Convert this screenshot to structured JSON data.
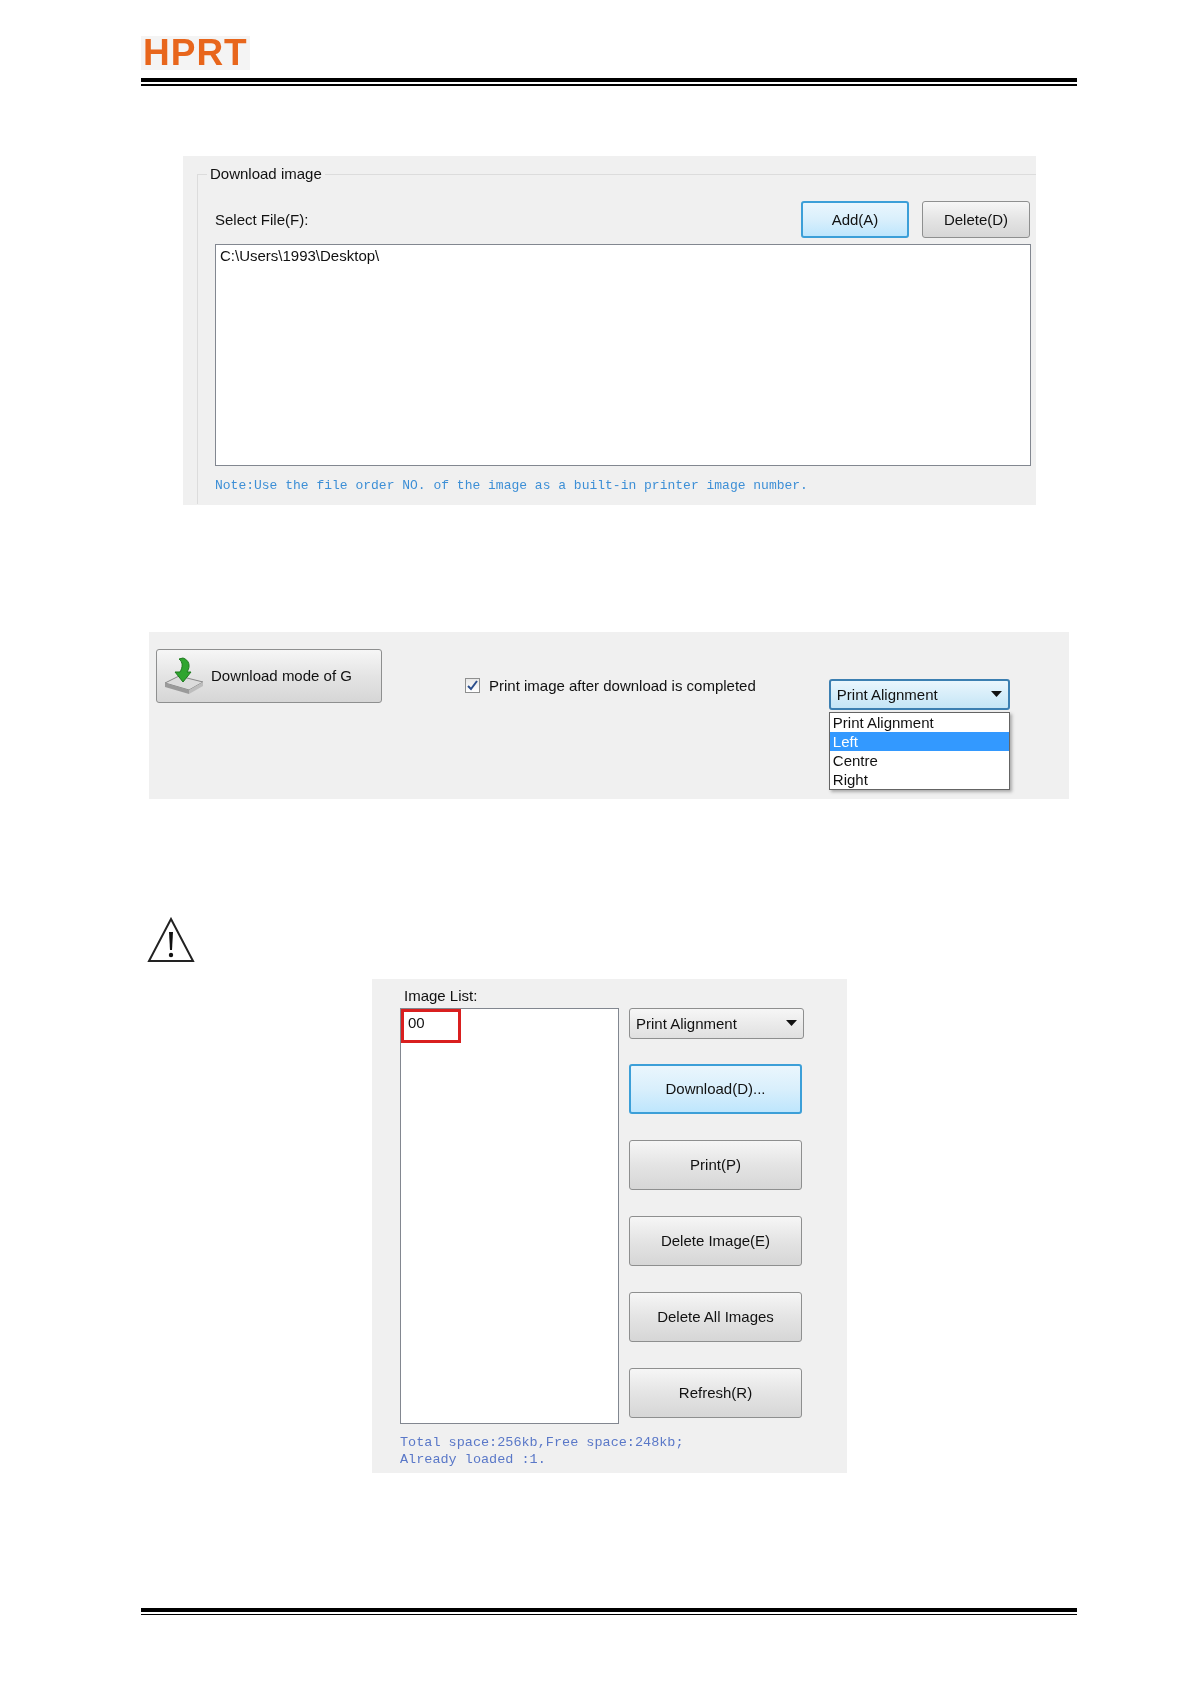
{
  "header": {
    "logo": "HPRT"
  },
  "download_image_panel": {
    "group_title": "Download image",
    "select_file_label": "Select File(F):",
    "buttons": [
      {
        "label": "Add(A)",
        "focused": true
      },
      {
        "label": "Delete(D)",
        "focused": false
      }
    ],
    "file_list": [
      "C:\\Users\\1993\\Desktop\\"
    ],
    "note": "Note:Use the file order NO. of the image as a built-in printer image number."
  },
  "download_mode_panel": {
    "mode_button": "Download mode of G",
    "print_after_checkbox": {
      "label": "Print image after download is completed",
      "checked": true
    },
    "alignment_dropdown": {
      "value": "Print Alignment",
      "expanded": true,
      "options": [
        {
          "label": "Print Alignment",
          "highlighted": false
        },
        {
          "label": "Left",
          "highlighted": true
        },
        {
          "label": "Centre",
          "highlighted": false
        },
        {
          "label": "Right",
          "highlighted": false
        }
      ]
    }
  },
  "image_list_panel": {
    "label": "Image List:",
    "items": [
      {
        "label": "00",
        "highlighted": true
      }
    ],
    "alignment_dropdown": {
      "value": "Print Alignment",
      "expanded": false
    },
    "buttons": [
      {
        "label": "Download(D)...",
        "focused": true
      },
      {
        "label": "Print(P)",
        "focused": false
      },
      {
        "label": "Delete Image(E)",
        "focused": false
      },
      {
        "label": "Delete All Images",
        "focused": false
      },
      {
        "label": "Refresh(R)",
        "focused": false
      }
    ],
    "status": [
      "Total space:256kb,Free space:248kb;",
      "Already loaded :1."
    ]
  }
}
